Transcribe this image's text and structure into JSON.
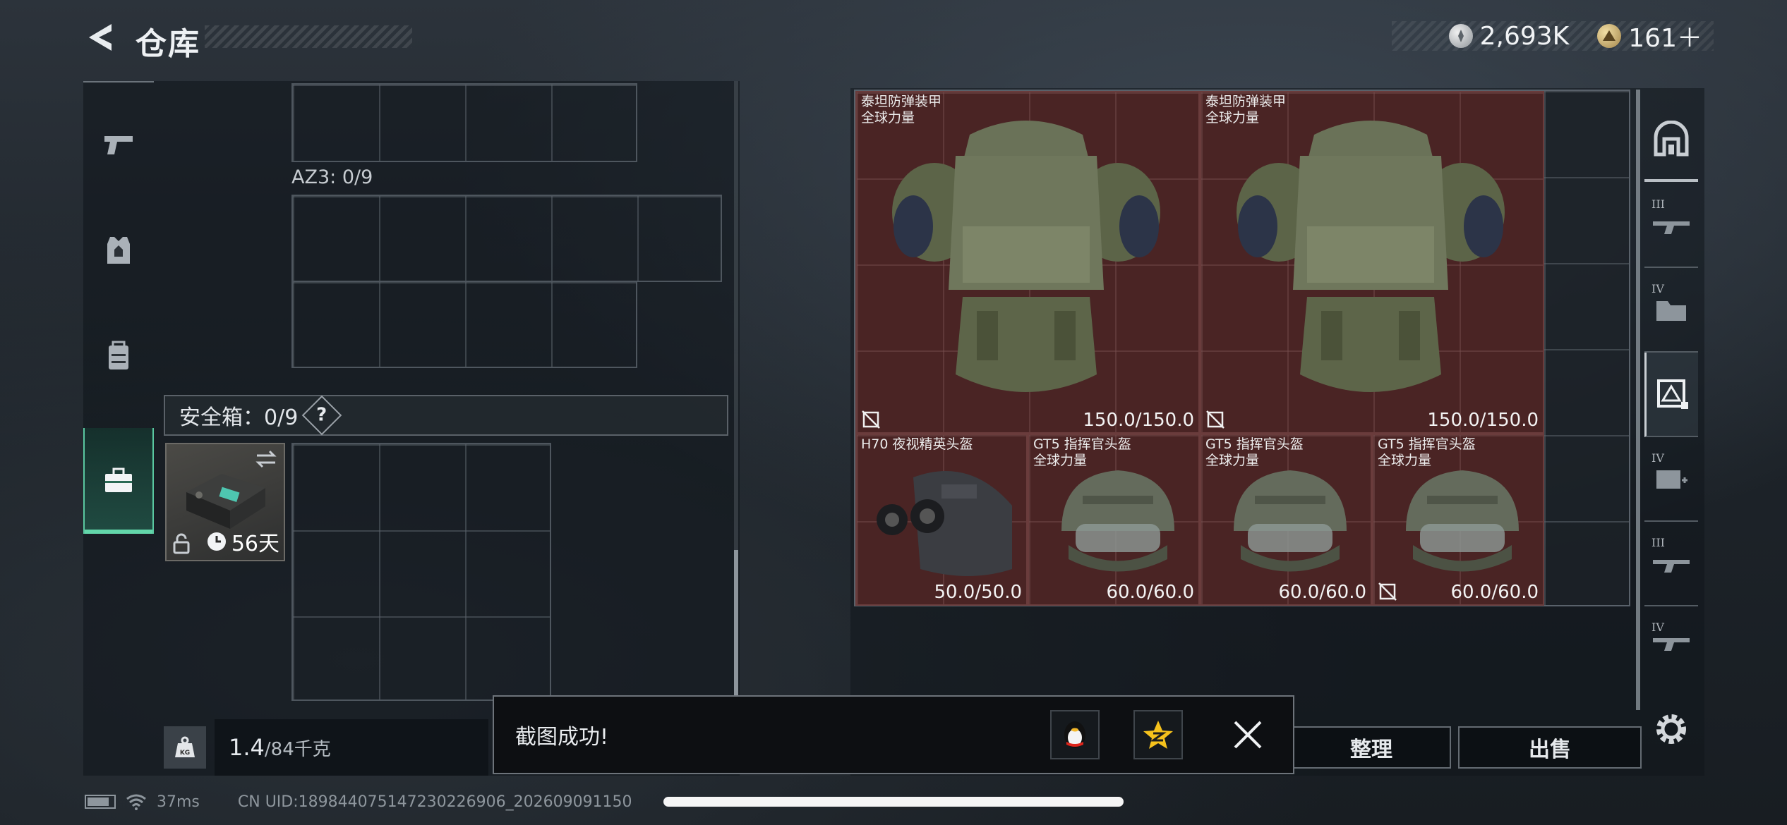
{
  "header": {
    "title": "仓库",
    "currency": [
      {
        "icon": "silver-coin-icon",
        "value": "2,693K"
      },
      {
        "icon": "gold-coin-icon",
        "value": "161＋"
      }
    ]
  },
  "left_rail": {
    "tabs": [
      {
        "name": "weapon-tab",
        "icon": "pistol-icon",
        "active": false
      },
      {
        "name": "vest-tab",
        "icon": "vest-icon",
        "active": false
      },
      {
        "name": "backpack-tab",
        "icon": "backpack-icon",
        "active": false
      },
      {
        "name": "safebox-tab",
        "icon": "toolbox-icon",
        "active": true
      }
    ]
  },
  "storage": {
    "az3_label": "AZ3: 0/9",
    "safebox_label": "安全箱：0/9",
    "safebox_help": "?",
    "safebox_days": "56天",
    "weight_current": "1.4",
    "weight_max": "/84千克"
  },
  "items": [
    {
      "name": "泰坦防弹装甲\n全球力量",
      "durability": "150.0/150.0",
      "flag": true
    },
    {
      "name": "泰坦防弹装甲\n全球力量",
      "durability": "150.0/150.0",
      "flag": true
    },
    {
      "name": "H70 夜视精英头盔",
      "durability": "50.0/50.0",
      "flag": false
    },
    {
      "name": "GT5 指挥官头盔\n全球力量",
      "durability": "60.0/60.0",
      "flag": false
    },
    {
      "name": "GT5 指挥官头盔\n全球力量",
      "durability": "60.0/60.0",
      "flag": false
    },
    {
      "name": "GT5 指挥官头盔\n全球力量",
      "durability": "60.0/60.0",
      "flag": true
    }
  ],
  "right_rail": {
    "tiers": [
      "III",
      "IV",
      "",
      "IV",
      "III",
      "IV"
    ]
  },
  "actions": {
    "sort_label": "整理",
    "sell_label": "出售"
  },
  "toast": {
    "message": "截图成功!"
  },
  "status": {
    "ping": "37ms",
    "uid": "CN UID:18984407514723022690​6_202609091150"
  },
  "colors": {
    "accent_green": "#62d6aa",
    "item_bg": "#4a2424"
  }
}
